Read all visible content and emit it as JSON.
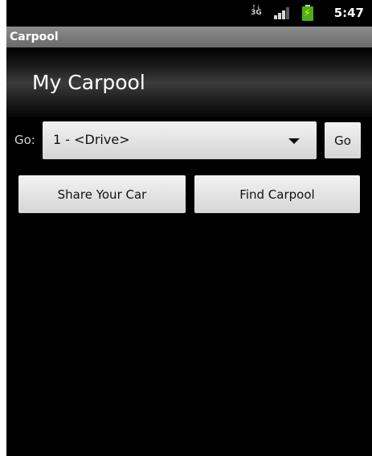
{
  "status_bar": {
    "network_arrows": "↑↓",
    "network_type": "3G",
    "time": "5:47",
    "battery_color": "#4caf1a"
  },
  "title_bar": {
    "title": "Carpool"
  },
  "header": {
    "heading": "My Carpool"
  },
  "go_row": {
    "label": "Go:",
    "spinner_value": "1 - <Drive>",
    "go_button_label": "Go"
  },
  "actions": {
    "share_label": "Share Your Car",
    "find_label": "Find Carpool"
  }
}
